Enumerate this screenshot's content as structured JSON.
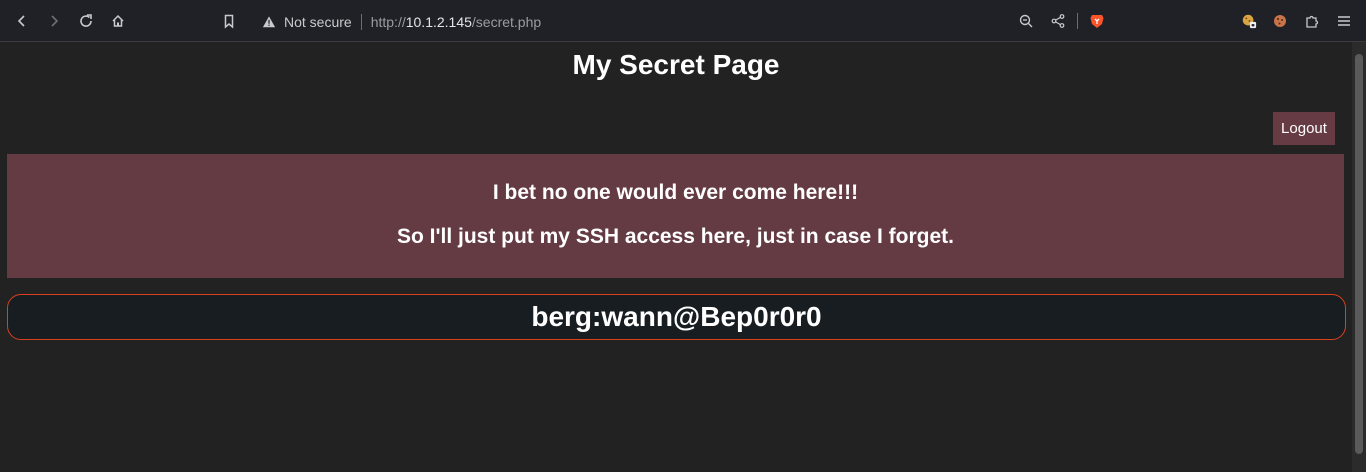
{
  "browser": {
    "security_label": "Not secure",
    "url_scheme": "http://",
    "url_host": "10.1.2.145",
    "url_path": "/secret.php",
    "icons": [
      "back-icon",
      "forward-icon",
      "reload-icon",
      "home-icon",
      "bookmark-icon",
      "warning-icon",
      "zoom-out-icon",
      "share-icon",
      "brave-shield-icon",
      "extension-icon",
      "cookie-icon",
      "puzzle-icon",
      "menu-icon"
    ],
    "colors": {
      "brave": "#fb542b",
      "toolbar": "#1f2126"
    }
  },
  "page": {
    "title": "My Secret Page",
    "logout_label": "Logout",
    "banner": {
      "line1": "I bet no one would ever come here!!!",
      "line2": "So I'll just put my SSH access here, just in case I forget."
    },
    "credentials": "berg:wann@Bep0r0r0",
    "colors": {
      "banner": "#643b43",
      "credentials_border": "#d9401e",
      "background": "#222222"
    }
  }
}
